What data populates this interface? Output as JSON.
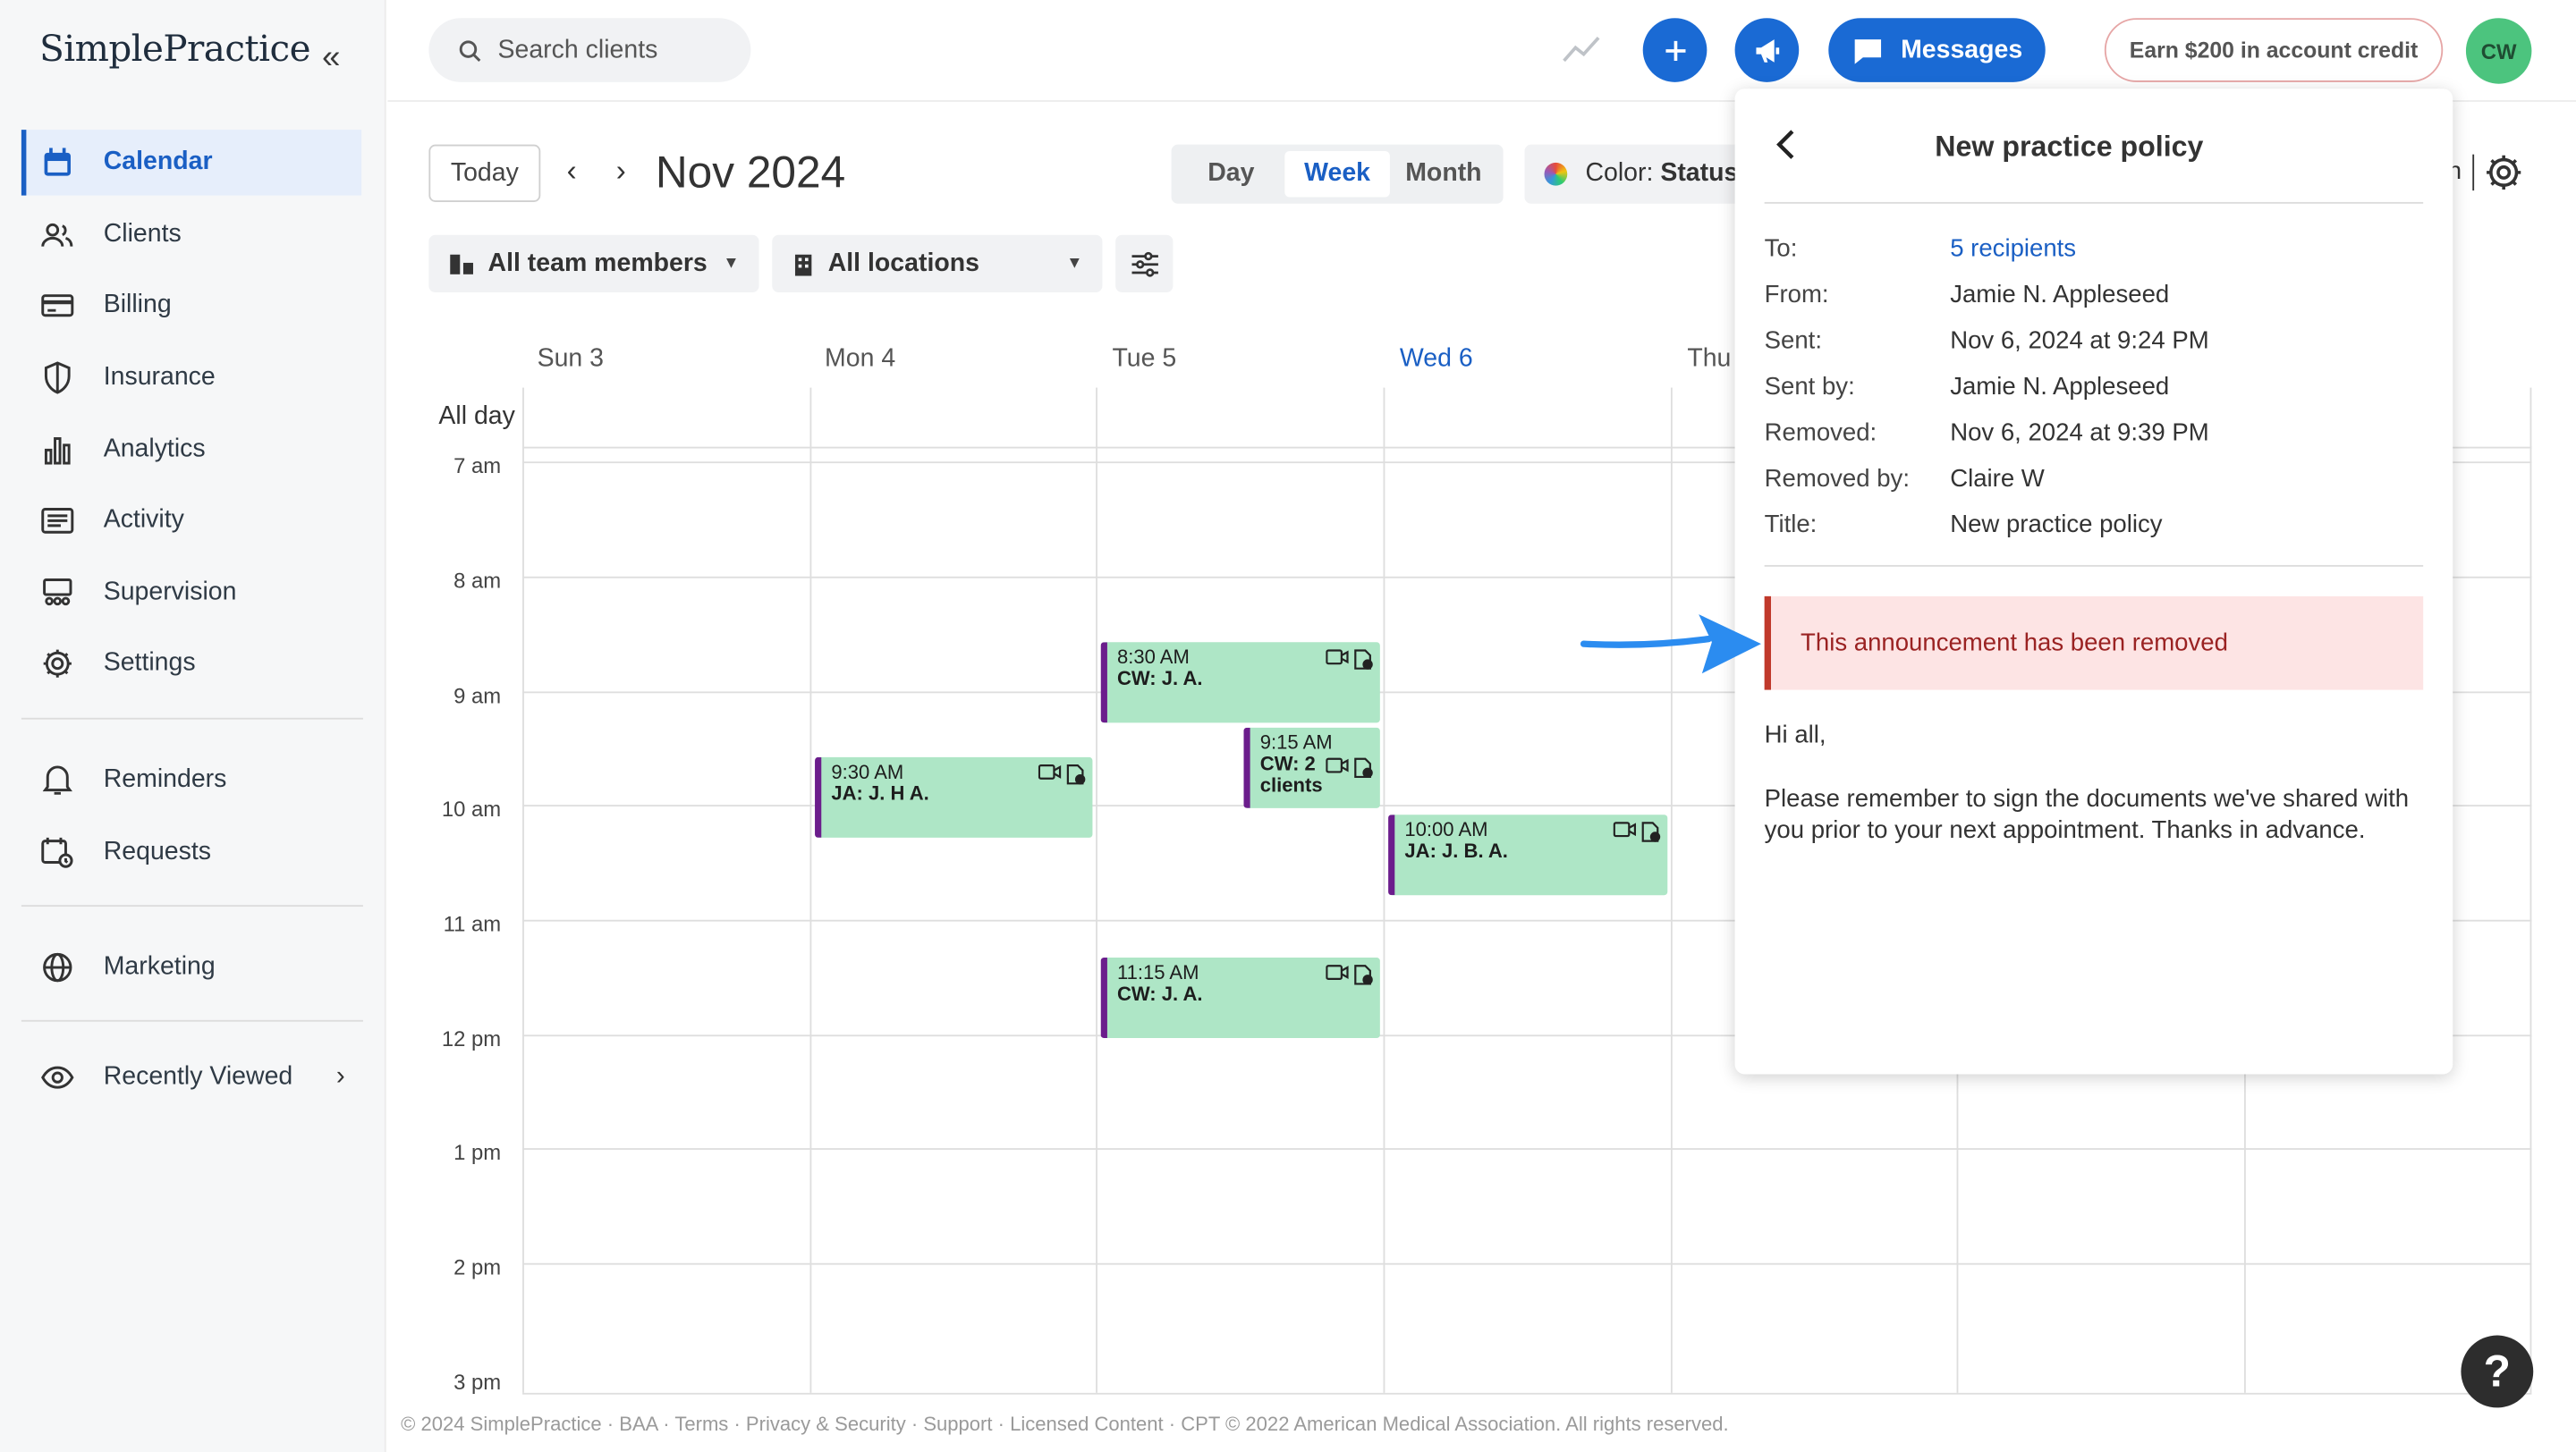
{
  "sidebar": {
    "logo": "SimplePractice",
    "items": [
      {
        "label": "Calendar"
      },
      {
        "label": "Clients"
      },
      {
        "label": "Billing"
      },
      {
        "label": "Insurance"
      },
      {
        "label": "Analytics"
      },
      {
        "label": "Activity"
      },
      {
        "label": "Supervision"
      },
      {
        "label": "Settings"
      },
      {
        "label": "Reminders"
      },
      {
        "label": "Requests"
      },
      {
        "label": "Marketing"
      },
      {
        "label": "Recently Viewed"
      }
    ]
  },
  "topbar": {
    "search_placeholder": "Search clients",
    "messages_label": "Messages",
    "credit_label": "Earn $200 in account credit",
    "avatar_initials": "CW"
  },
  "toolbar": {
    "today_label": "Today",
    "month_label": "Nov 2024",
    "views": [
      "Day",
      "Week",
      "Month"
    ],
    "color_label": "Color:",
    "color_value": "Status",
    "team_filter": "All team members",
    "location_filter": "All locations",
    "right_partial": "h"
  },
  "calendar": {
    "days": [
      "Sun 3",
      "Mon 4",
      "Tue 5",
      "Wed 6",
      "Thu"
    ],
    "allday_label": "All day",
    "hours": [
      "7 am",
      "8 am",
      "9 am",
      "10 am",
      "11 am",
      "12 pm",
      "1 pm",
      "2 pm",
      "3 pm"
    ],
    "appointments": [
      {
        "time": "8:30 AM",
        "who": "CW: J. A."
      },
      {
        "time": "9:30 AM",
        "who": "JA: J. H A."
      },
      {
        "time": "9:15 AM",
        "who": "CW: 2",
        "who2": "clients"
      },
      {
        "time": "10:00 AM",
        "who": "JA: J. B. A."
      },
      {
        "time": "11:15 AM",
        "who": "CW: J. A."
      }
    ]
  },
  "panel": {
    "title": "New practice policy",
    "meta": [
      {
        "key": "To:",
        "value": "5 recipients"
      },
      {
        "key": "From:",
        "value": "Jamie N. Appleseed"
      },
      {
        "key": "Sent:",
        "value": "Nov 6, 2024 at 9:24 PM"
      },
      {
        "key": "Sent by:",
        "value": "Jamie N. Appleseed"
      },
      {
        "key": "Removed:",
        "value": "Nov 6, 2024 at 9:39 PM"
      },
      {
        "key": "Removed by:",
        "value": "Claire W"
      },
      {
        "key": "Title:",
        "value": "New practice policy"
      }
    ],
    "removed_notice": "This announcement has been removed",
    "greeting": "Hi all,",
    "body": "Please remember to sign the documents we've shared with you prior to your next appointment. Thanks in advance."
  },
  "footer": "© 2024 SimplePractice · BAA · Terms · Privacy & Security · Support · Licensed Content · CPT © 2022 American Medical Association. All rights reserved.",
  "help_label": "?",
  "colors": {
    "accent": "#1a6ad4",
    "appointment": "#aee6c6",
    "appointment_border": "#6b1d8c",
    "removed_bg": "#fde4e4",
    "removed_border": "#c0392b"
  }
}
